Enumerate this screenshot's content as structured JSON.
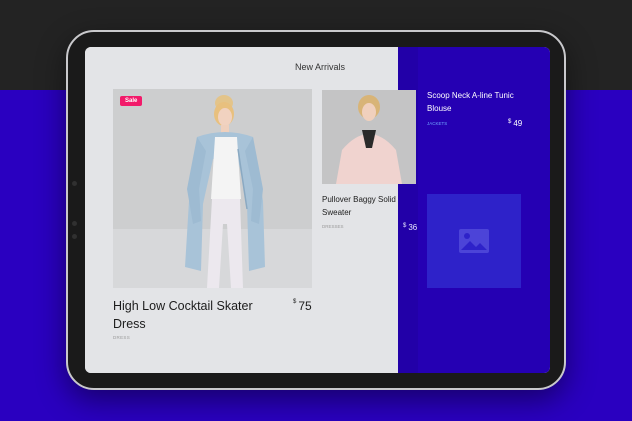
{
  "page": {
    "title": "New Arrivals"
  },
  "featured_product": {
    "badge": "Sale",
    "name": "High Low Cocktail Skater Dress",
    "currency": "$",
    "price": "75",
    "category": "DRESS"
  },
  "products": [
    {
      "name": "Pullover Baggy Solid Sweater",
      "currency": "$",
      "price": "36",
      "category": "DRESSES"
    },
    {
      "name": "Scoop Neck A-line Tunic Blouse",
      "currency": "$",
      "price": "49",
      "category": "JACKETS"
    },
    {
      "image_icon": "image-placeholder-icon"
    }
  ],
  "colors": {
    "background_top": "#232323",
    "background_bottom": "#2a00c0",
    "panel_accent": "#2500b3",
    "sale_badge": "#f21a6a",
    "category_link": "#6fa4ff"
  }
}
